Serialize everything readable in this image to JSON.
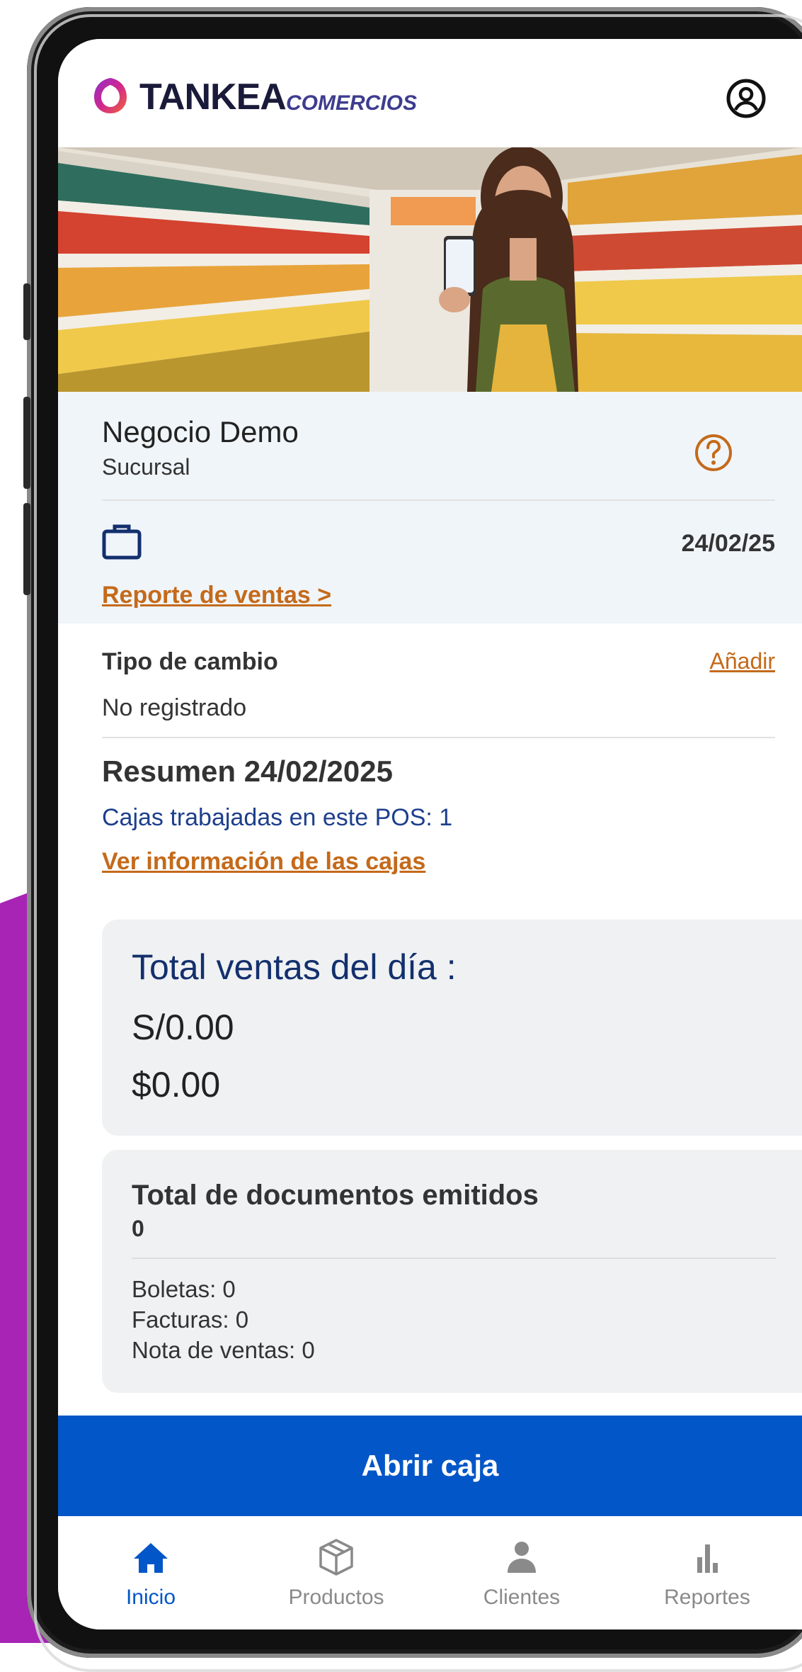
{
  "header": {
    "brand_name": "TANKEA",
    "brand_sub": "COMERCIOS",
    "icons": {
      "user": "user-circle-icon",
      "logo": "tankea-logo-icon"
    }
  },
  "business": {
    "name": "Negocio Demo",
    "branch": "Sucursal",
    "date": "24/02/25",
    "sales_report_link": "Reporte de ventas >",
    "icons": {
      "help": "help-circle-icon",
      "briefcase": "briefcase-icon"
    }
  },
  "exchange": {
    "label": "Tipo de cambio",
    "add_link": "Añadir",
    "status": "No registrado"
  },
  "summary": {
    "title": "Resumen 24/02/2025",
    "cash_registers": "Cajas trabajadas en este POS: 1",
    "view_registers_link": "Ver información de las cajas"
  },
  "sales_card": {
    "title": "Total ventas del día :",
    "soles": "S/0.00",
    "dollars": "$0.00"
  },
  "documents_card": {
    "title": "Total de documentos emitidos",
    "count": "0",
    "boletas": "Boletas: 0",
    "facturas": "Facturas: 0",
    "notas": "Nota de ventas: 0"
  },
  "actions": {
    "open_register": "Abrir caja"
  },
  "nav": {
    "items": [
      {
        "label": "Inicio",
        "icon": "home-icon",
        "active": true
      },
      {
        "label": "Productos",
        "icon": "box-icon",
        "active": false
      },
      {
        "label": "Clientes",
        "icon": "person-icon",
        "active": false
      },
      {
        "label": "Reportes",
        "icon": "bar-chart-icon",
        "active": false
      }
    ]
  },
  "colors": {
    "primary": "#0356c7",
    "link": "#c46a1a",
    "background_accent": "#a724b5",
    "card": "#f0f1f3"
  }
}
